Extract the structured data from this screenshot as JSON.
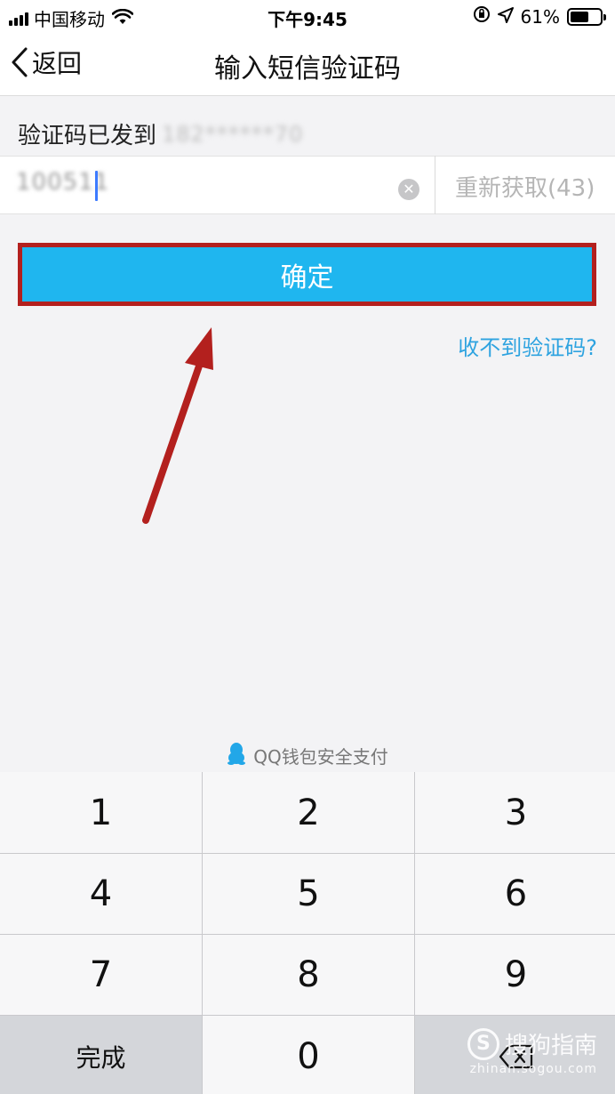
{
  "status_bar": {
    "carrier": "中国移动",
    "time": "下午9:45",
    "battery_percent": "61%",
    "battery_level": 0.61
  },
  "nav": {
    "back_label": "返回",
    "title": "输入短信验证码"
  },
  "sent_text": "验证码已发到",
  "masked_phone": "182******70",
  "code_input_value": "100511",
  "resend_label": "重新获取(43)",
  "confirm_label": "确定",
  "help_link": "收不到验证码?",
  "secure_text": "QQ钱包安全支付",
  "keypad": {
    "k1": "1",
    "k2": "2",
    "k3": "3",
    "k4": "4",
    "k5": "5",
    "k6": "6",
    "k7": "7",
    "k8": "8",
    "k9": "9",
    "done": "完成",
    "k0": "0"
  },
  "watermark": {
    "name": "搜狗指南",
    "url": "zhinan.sogou.com"
  },
  "colors": {
    "accent": "#1fb6ef",
    "highlight_border": "#b3201e",
    "link": "#2ea3e0"
  }
}
